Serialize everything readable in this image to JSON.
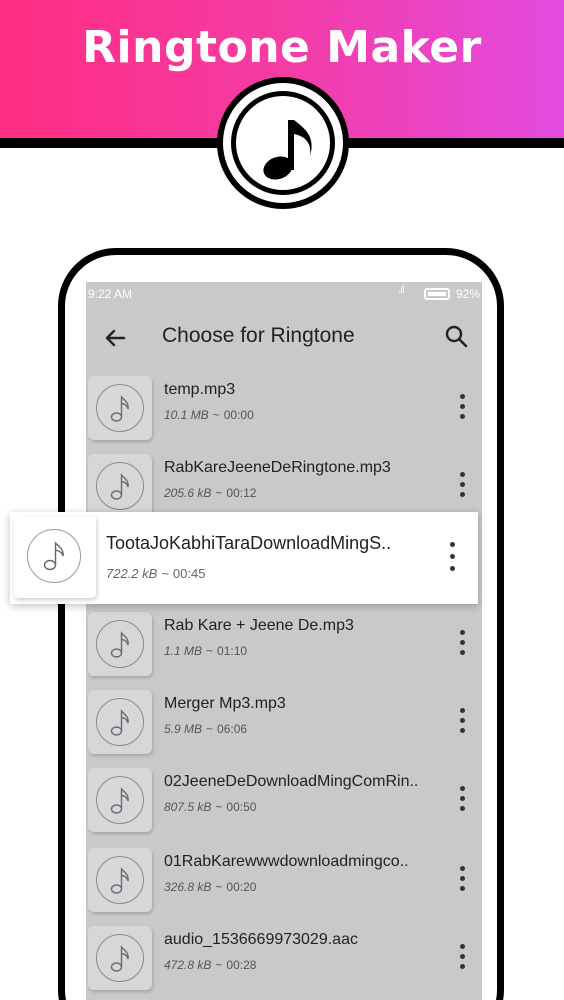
{
  "banner": {
    "title": "Ringtone Maker",
    "logo_icon": "music-note-icon",
    "gradient": [
      "#ff2d82",
      "#e24be0"
    ]
  },
  "status_bar": {
    "time": "9:22 AM",
    "signal": ".ıl",
    "battery_percent": "92%"
  },
  "app_bar": {
    "back_icon": "arrow-left-icon",
    "title": "Choose for Ringtone",
    "search_icon": "search-icon"
  },
  "files": [
    {
      "name": "temp.mp3",
      "size": "10.1 MB",
      "duration": "00:00"
    },
    {
      "name": "RabKareJeeneDeRingtone.mp3",
      "size": "205.6 kB",
      "duration": "00:12"
    },
    {
      "name": "TootaJoKabhiTaraDownloadMingS..",
      "size": "722.2 kB",
      "duration": "00:45",
      "highlighted": true
    },
    {
      "name": "Rab Kare + Jeene De.mp3",
      "size": "1.1 MB",
      "duration": "01:10"
    },
    {
      "name": "Merger Mp3.mp3",
      "size": "5.9 MB",
      "duration": "06:06"
    },
    {
      "name": "02JeeneDeDownloadMingComRin..",
      "size": "807.5 kB",
      "duration": "00:50"
    },
    {
      "name": "01RabKarewwwdownloadmingco..",
      "size": "326.8 kB",
      "duration": "00:20"
    },
    {
      "name": "audio_1536669973029.aac",
      "size": "472.8 kB",
      "duration": "00:28"
    }
  ],
  "separator": "~"
}
